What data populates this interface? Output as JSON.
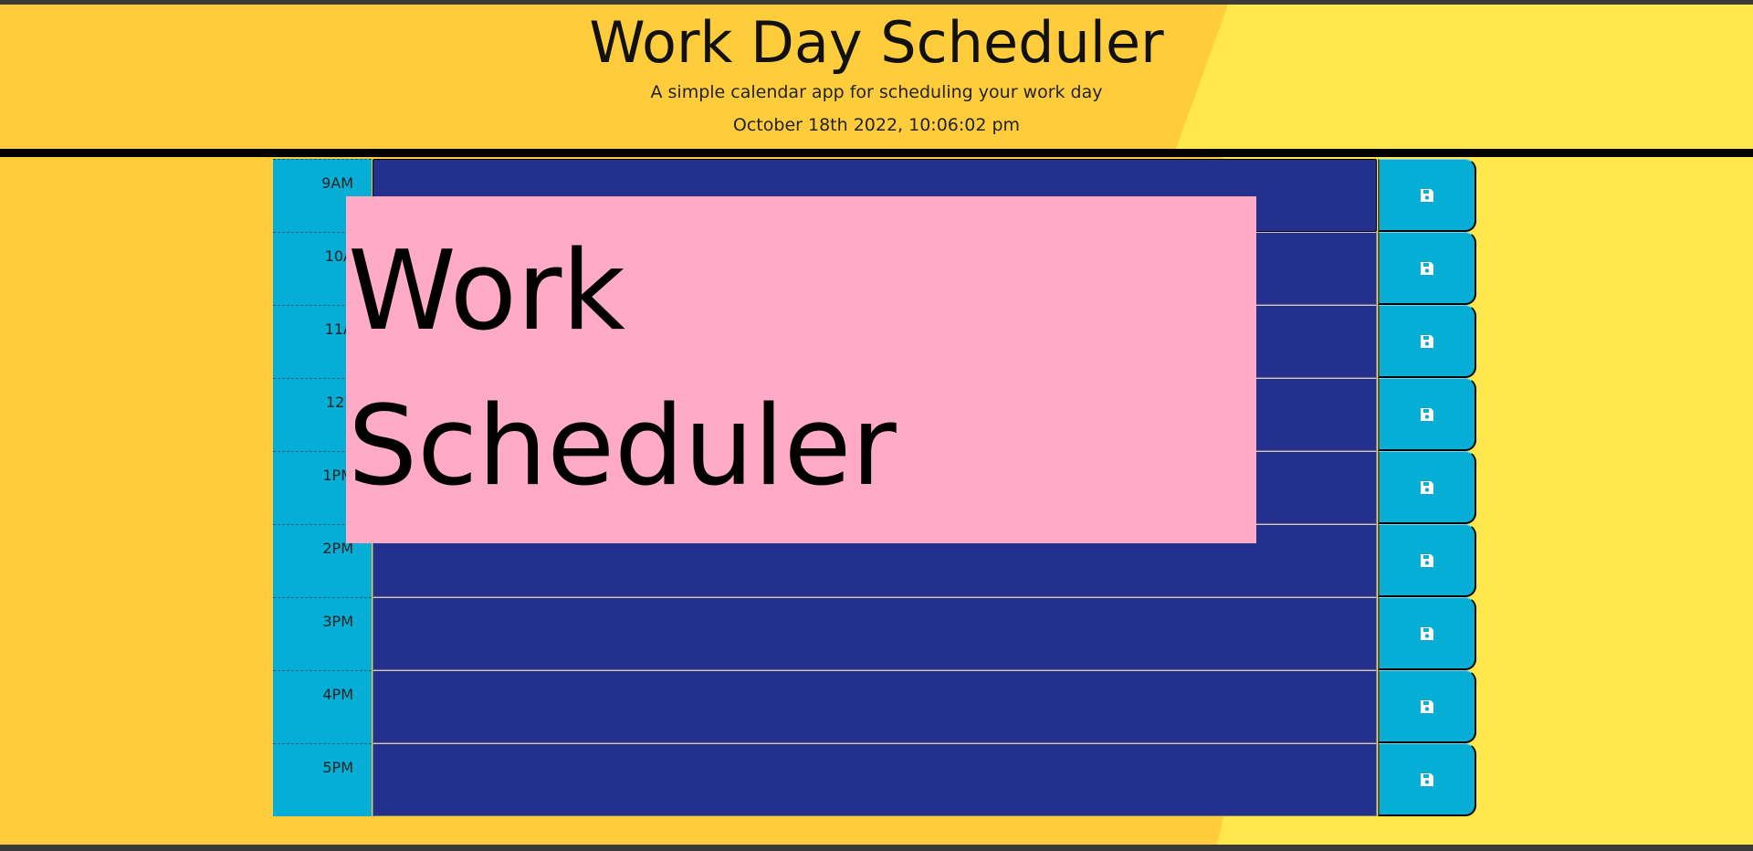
{
  "header": {
    "title": "Work Day Scheduler",
    "subtitle": "A simple calendar app for scheduling your work day",
    "datetime": "October 18th 2022, 10:06:02 pm"
  },
  "overlay": {
    "line1": "Work",
    "line2": "Scheduler"
  },
  "rows": [
    {
      "hour": "9AM"
    },
    {
      "hour": "10A"
    },
    {
      "hour": "11A"
    },
    {
      "hour": "12P"
    },
    {
      "hour": "1PM"
    },
    {
      "hour": "2PM"
    },
    {
      "hour": "3PM"
    },
    {
      "hour": "4PM"
    },
    {
      "hour": "5PM"
    }
  ],
  "colors": {
    "background_left": "#ffcd3c",
    "background_right": "#ffe74c",
    "hour_block": "#06aed5",
    "future_block": "#23308e",
    "overlay": "#ffabc8"
  },
  "icons": {
    "save": "save-icon"
  }
}
